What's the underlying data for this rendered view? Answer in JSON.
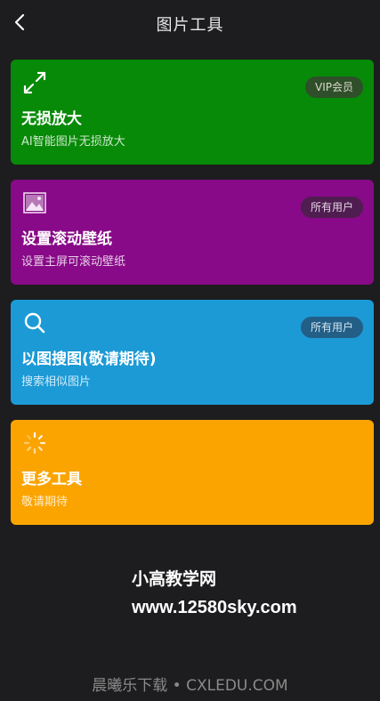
{
  "header": {
    "title": "图片工具",
    "back_icon": "chevron-left-icon"
  },
  "cards": [
    {
      "title": "无损放大",
      "desc": "AI智能图片无损放大",
      "badge": "VIP会员",
      "color": "#078a07",
      "badge_bg": "#2f4f2a",
      "badge_color": "#d9d9c8",
      "icon": "expand-arrows-icon"
    },
    {
      "title": "设置滚动壁纸",
      "desc": "设置主屏可滚动壁纸",
      "badge": "所有用户",
      "color": "#880a88",
      "badge_bg": "#4f1d50",
      "badge_color": "#e5d6e6",
      "icon": "image-icon"
    },
    {
      "title": "以图搜图(敬请期待)",
      "desc": "搜索相似图片",
      "badge": "所有用户",
      "color": "#1c9ad6",
      "badge_bg": "#235e86",
      "badge_color": "#d4e7f2",
      "icon": "search-icon"
    },
    {
      "title": "更多工具",
      "desc": "敬请期待",
      "badge": "",
      "color": "#fba400",
      "icon": "loading-spinner-icon"
    }
  ],
  "watermark": {
    "line1": "小高教学网",
    "line2": "www.12580sky.com"
  },
  "footer": {
    "text": "晨曦乐下载 • CXLEDU.COM"
  }
}
